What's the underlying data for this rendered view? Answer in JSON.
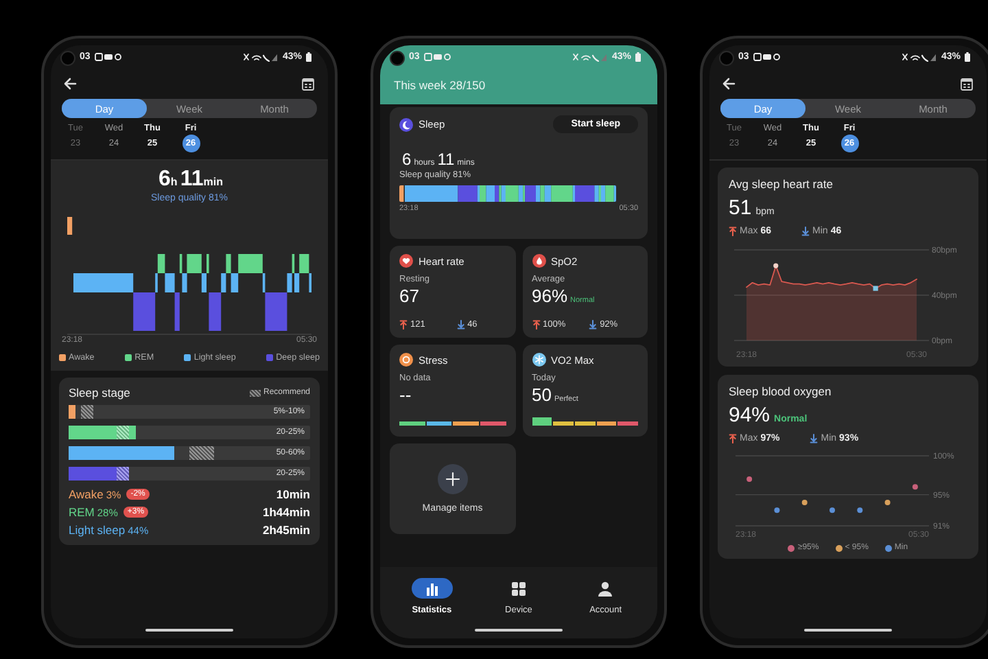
{
  "phones": [
    {
      "kind": "sleep_detail",
      "status_bar": {
        "time": "03",
        "battery": "43%"
      },
      "tabs": [
        {
          "label": "Day",
          "selected": true
        },
        {
          "label": "Week",
          "selected": false
        },
        {
          "label": "Month",
          "selected": false
        }
      ],
      "dates": [
        {
          "weekday": "Tue",
          "day": "23",
          "selected": false,
          "has_data": false,
          "faded": true
        },
        {
          "weekday": "Wed",
          "day": "24",
          "selected": false,
          "has_data": false,
          "faded": false
        },
        {
          "weekday": "Thu",
          "day": "25",
          "selected": false,
          "has_data": true,
          "faded": false
        },
        {
          "weekday": "Fri",
          "day": "26",
          "selected": true,
          "has_data": true,
          "faded": false
        }
      ],
      "duration": [
        {
          "value": "6",
          "unit": "h"
        },
        {
          "value": "11",
          "unit": "min"
        }
      ],
      "quality": "Sleep quality 81%",
      "chart_axis": [
        "23:18",
        "05:30"
      ],
      "legend": [
        {
          "label": "Awake",
          "color": "#f2a064"
        },
        {
          "label": "REM",
          "color": "#62d68a"
        },
        {
          "label": "Light sleep",
          "color": "#5cb3f4"
        },
        {
          "label": "Deep sleep",
          "color": "#5a4fde"
        }
      ],
      "sleep_stage": {
        "title": "Sleep stage",
        "recommend_label": "Recommend",
        "bars": [
          {
            "color": "#f2a064",
            "level": 0.03,
            "recommend_start": {
              "level": 0.05
            },
            "recommend_end": {
              "level": 0.1
            },
            "range": "5%-10%"
          },
          {
            "color": "#62d68a",
            "level": 0.28,
            "recommend_start": {
              "level": 0.2
            },
            "recommend_end": {
              "level": 0.25
            },
            "range": "20-25%"
          },
          {
            "color": "#5cb3f4",
            "level": 0.44,
            "recommend_start": {
              "level": 0.5
            },
            "recommend_end": {
              "level": 0.6
            },
            "range": "50-60%"
          },
          {
            "color": "#5a4fde",
            "level": 0.25,
            "recommend_start": {
              "level": 0.2
            },
            "recommend_end": {
              "level": 0.25
            },
            "range": "20-25%"
          }
        ],
        "stages": [
          {
            "name": "Awake",
            "percent": "3%",
            "change": "-2%",
            "duration": "10min",
            "color": "#f2a064"
          },
          {
            "name": "REM",
            "percent": "28%",
            "change": "+3%",
            "duration": "1h44min",
            "color": "#62d68a"
          },
          {
            "name": "Light sleep",
            "percent": "44%",
            "duration": "2h45min",
            "color": "#5cb3f4"
          }
        ]
      }
    },
    {
      "kind": "stats_home",
      "status_bar": {
        "time": "03",
        "battery": "43%"
      },
      "header": "This week 28/150",
      "sleep_card": {
        "title": "Sleep",
        "button": "Start sleep",
        "duration": [
          {
            "value": "6",
            "unit": "hours"
          },
          {
            "value": "11",
            "unit": "mins"
          }
        ],
        "quality": "Sleep quality 81%",
        "stages": [
          {
            "color": "#f2a064"
          },
          {
            "color": "#62d68a"
          },
          {
            "color": "#5cb3f4"
          },
          {
            "color": "#5a4fde"
          }
        ],
        "timeline_axis": [
          "23:18",
          "05:30"
        ]
      },
      "tiles": [
        {
          "kind": "heart",
          "title": "Heart rate",
          "subtitle": "Resting",
          "value": "67",
          "max": "121",
          "min": "46"
        },
        {
          "kind": "spo2",
          "title": "SpO2",
          "subtitle": "Average",
          "value": "96%",
          "qualifier": {
            "text": "Normal",
            "color": "#4cc37a"
          },
          "max": "100%",
          "min": "92%"
        },
        {
          "kind": "stress",
          "title": "Stress",
          "subtitle": "No data",
          "value": "--",
          "scale": [
            {
              "color": "#5fd07f",
              "selected": false
            },
            {
              "color": "#5ab8e8",
              "selected": false
            },
            {
              "color": "#f0a050",
              "selected": false
            },
            {
              "color": "#e0586a",
              "selected": false
            }
          ]
        },
        {
          "kind": "vo2",
          "title": "VO2 Max",
          "subtitle": "Today",
          "value": "50",
          "qualifier": {
            "text": "Perfect",
            "color": "#cccccc"
          },
          "scale": [
            {
              "color": "#5fd07f",
              "selected": true
            },
            {
              "color": "#e0c040",
              "selected": false
            },
            {
              "color": "#e0c040",
              "selected": false
            },
            {
              "color": "#f0a050",
              "selected": false
            },
            {
              "color": "#e0586a",
              "selected": false
            }
          ]
        }
      ],
      "manage": "Manage items",
      "nav": [
        {
          "kind": "statistics",
          "label": "Statistics",
          "selected": true
        },
        {
          "kind": "device",
          "label": "Device",
          "selected": false
        },
        {
          "kind": "account",
          "label": "Account",
          "selected": false
        }
      ]
    },
    {
      "kind": "heart_detail",
      "status_bar": {
        "time": "03",
        "battery": "43%"
      },
      "tabs": [
        {
          "label": "Day",
          "selected": true
        },
        {
          "label": "Week",
          "selected": false
        },
        {
          "label": "Month",
          "selected": false
        }
      ],
      "dates": [
        {
          "weekday": "Tue",
          "day": "23",
          "selected": false,
          "has_data": false,
          "faded": true
        },
        {
          "weekday": "Wed",
          "day": "24",
          "selected": false,
          "has_data": false,
          "faded": false
        },
        {
          "weekday": "Thu",
          "day": "25",
          "selected": false,
          "has_data": true,
          "faded": false
        },
        {
          "weekday": "Fri",
          "day": "26",
          "selected": true,
          "has_data": true,
          "faded": false
        }
      ],
      "heart_card": {
        "title": "Avg sleep heart rate",
        "value": "51",
        "unit": "bpm",
        "max_label": "Max",
        "max": "66",
        "min_label": "Min",
        "min": "46",
        "chart_data": {
          "type": "area",
          "categories": [
            "23:18",
            null,
            null,
            null,
            null,
            null,
            null,
            null,
            null,
            null,
            null,
            null,
            null,
            null,
            null,
            null,
            null,
            null,
            null,
            null,
            null,
            null,
            null,
            null,
            null,
            null,
            null,
            null,
            null,
            "05:30"
          ],
          "series": [
            {
              "color": "#d9584f",
              "values": [
                47,
                51,
                49,
                50,
                49,
                66,
                52,
                51,
                50,
                50,
                49,
                50,
                51,
                50,
                51,
                50,
                49,
                50,
                51,
                50,
                49,
                50,
                46,
                49,
                50,
                49,
                50,
                49,
                51,
                54
              ]
            }
          ],
          "ylim": [
            0,
            80
          ],
          "yticks": [
            {
              "value": 0,
              "label": "0bpm"
            },
            {
              "value": 40,
              "label": "40bpm"
            },
            {
              "value": 80,
              "label": "80bpm"
            }
          ]
        }
      },
      "oxygen_card": {
        "title": "Sleep blood oxygen",
        "value": "94%",
        "qualifier": {
          "text": "Normal",
          "color": "#4cc37a"
        },
        "max_label": "Max",
        "max": "97%",
        "min_label": "Min",
        "min": "93%",
        "chart_data": {
          "type": "scatter",
          "legend": "bottom",
          "categories": [
            "23:18",
            null,
            null,
            null,
            null,
            null,
            "05:30"
          ],
          "series": [
            {
              "name": "≥95%",
              "color": "#c8607a",
              "values": [
                97,
                null,
                null,
                null,
                null,
                null,
                96
              ]
            },
            {
              "name": "< 95%",
              "color": "#d9a05b",
              "values": [
                null,
                null,
                94,
                null,
                null,
                94,
                null
              ]
            },
            {
              "name": "Min",
              "color": "#5b8fd6",
              "values": [
                null,
                93,
                null,
                93,
                93,
                null,
                null
              ]
            }
          ],
          "ylim": [
            91,
            100
          ],
          "yticks": [
            {
              "value": 91,
              "label": "91%"
            },
            {
              "value": 95,
              "label": "95%"
            },
            {
              "value": 100,
              "label": "100%"
            }
          ]
        }
      }
    }
  ]
}
